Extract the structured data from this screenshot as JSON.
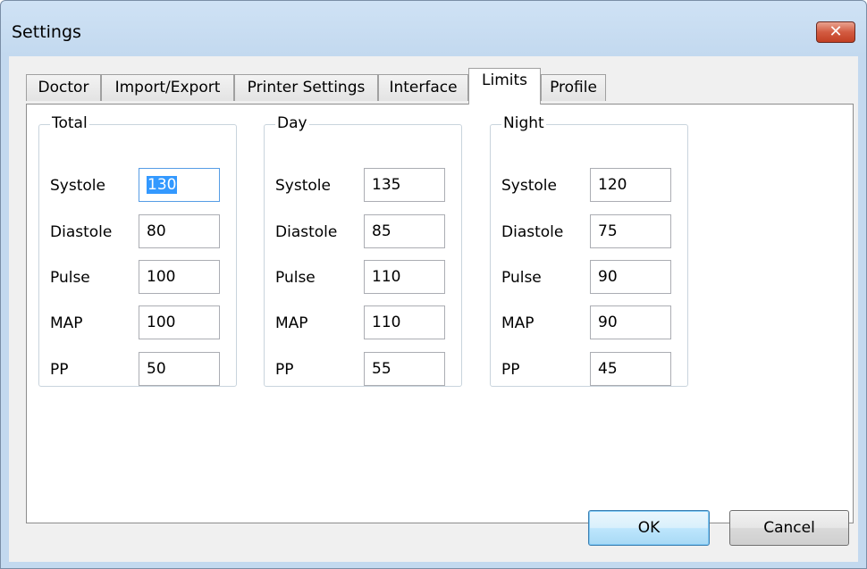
{
  "window": {
    "title": "Settings",
    "close_glyph": "✕"
  },
  "tabs": [
    {
      "label": "Doctor",
      "active": false
    },
    {
      "label": "Import/Export",
      "active": false
    },
    {
      "label": "Printer Settings",
      "active": false
    },
    {
      "label": "Interface",
      "active": false
    },
    {
      "label": "Limits",
      "active": true
    },
    {
      "label": "Profile",
      "active": false
    }
  ],
  "groups": [
    {
      "title": "Total",
      "fields": [
        {
          "label": "Systole",
          "value": "130",
          "focused": true
        },
        {
          "label": "Diastole",
          "value": "80"
        },
        {
          "label": "Pulse",
          "value": "100"
        },
        {
          "label": "MAP",
          "value": "100"
        },
        {
          "label": "PP",
          "value": "50"
        }
      ]
    },
    {
      "title": "Day",
      "fields": [
        {
          "label": "Systole",
          "value": "135"
        },
        {
          "label": "Diastole",
          "value": "85"
        },
        {
          "label": "Pulse",
          "value": "110"
        },
        {
          "label": "MAP",
          "value": "110"
        },
        {
          "label": "PP",
          "value": "55"
        }
      ]
    },
    {
      "title": "Night",
      "fields": [
        {
          "label": "Systole",
          "value": "120"
        },
        {
          "label": "Diastole",
          "value": "75"
        },
        {
          "label": "Pulse",
          "value": "90"
        },
        {
          "label": "MAP",
          "value": "90"
        },
        {
          "label": "PP",
          "value": "45"
        }
      ]
    }
  ],
  "buttons": {
    "ok": "OK",
    "cancel": "Cancel"
  },
  "colors": {
    "titlebar": "#c3d9ef",
    "close_button": "#c94a2f",
    "selection": "#3399ff"
  }
}
